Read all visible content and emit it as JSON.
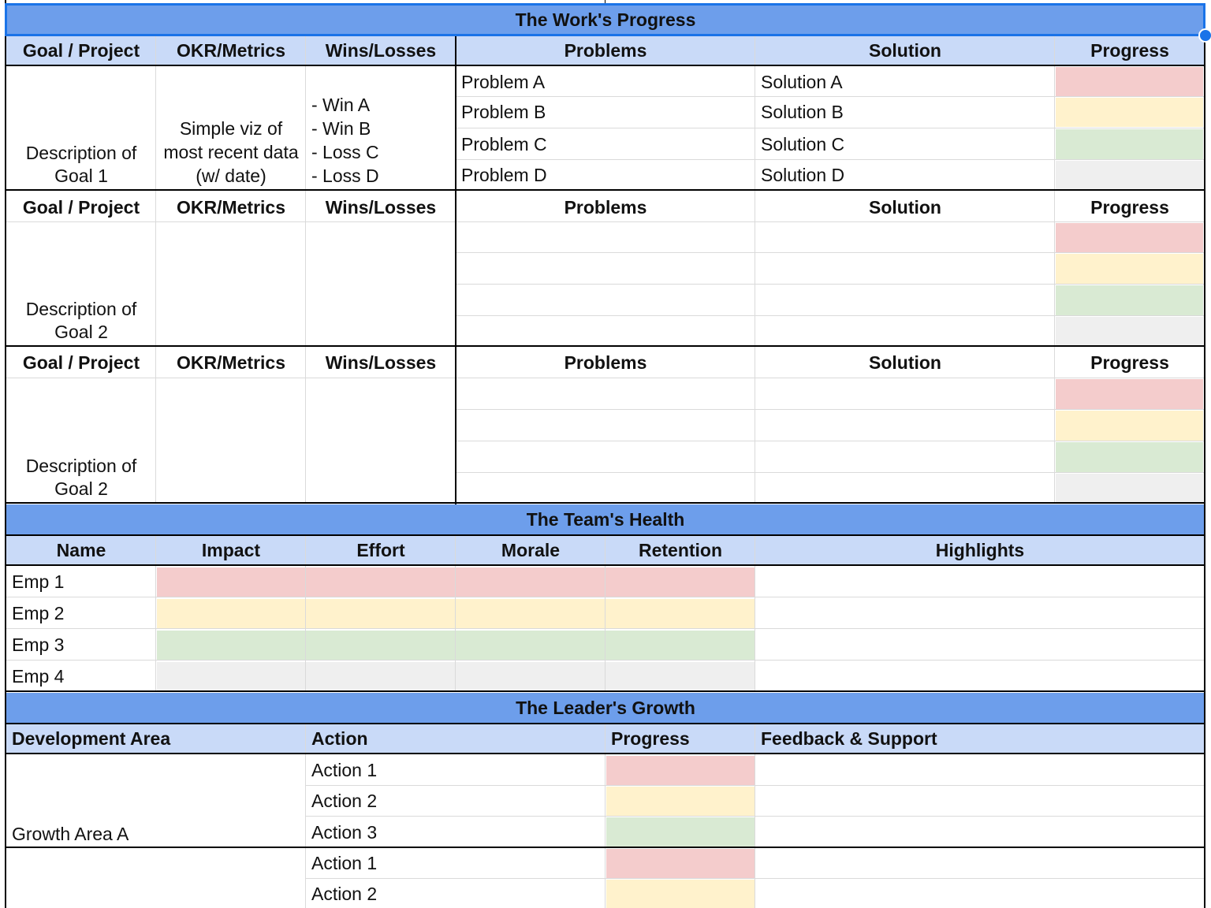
{
  "work": {
    "title": "The Work's Progress",
    "headers": [
      "Goal / Project",
      "OKR/Metrics",
      "Wins/Losses",
      "Problems",
      "Solution",
      "Progress"
    ],
    "blocks": [
      {
        "goal": "Description of Goal 1",
        "okr": "Simple viz of most recent data (w/ date)",
        "wins": [
          "- Win A",
          "- Win B",
          "- Loss C",
          "- Loss D"
        ],
        "problems": [
          "Problem A",
          "Problem B",
          "Problem C",
          "Problem D"
        ],
        "solutions": [
          "Solution A",
          "Solution B",
          "Solution C",
          "Solution D"
        ]
      },
      {
        "goal": "Description of Goal 2",
        "okr": "",
        "wins": [],
        "problems": [
          "",
          "",
          "",
          ""
        ],
        "solutions": [
          "",
          "",
          "",
          ""
        ]
      },
      {
        "goal": "Description of Goal 2",
        "okr": "",
        "wins": [],
        "problems": [
          "",
          "",
          "",
          ""
        ],
        "solutions": [
          "",
          "",
          "",
          ""
        ]
      }
    ]
  },
  "team": {
    "title": "The Team's Health",
    "headers": [
      "Name",
      "Impact",
      "Effort",
      "Morale",
      "Retention",
      "Highlights"
    ],
    "employees": [
      "Emp 1",
      "Emp 2",
      "Emp 3",
      "Emp 4"
    ]
  },
  "leader": {
    "title": "The Leader's Growth",
    "headers": [
      "Development Area",
      "Action",
      "Progress",
      "Feedback & Support"
    ],
    "areas": [
      {
        "name": "Growth Area A",
        "actions": [
          "Action 1",
          "Action 2",
          "Action 3"
        ]
      },
      {
        "name": "",
        "actions": [
          "Action 1",
          "Action 2"
        ]
      }
    ]
  },
  "status_colors": {
    "red": "#f4cccc",
    "yellow": "#fff2cc",
    "green": "#d9ead3",
    "grey": "#efefef",
    "section_header": "#6d9eeb",
    "column_header": "#c9daf8"
  }
}
